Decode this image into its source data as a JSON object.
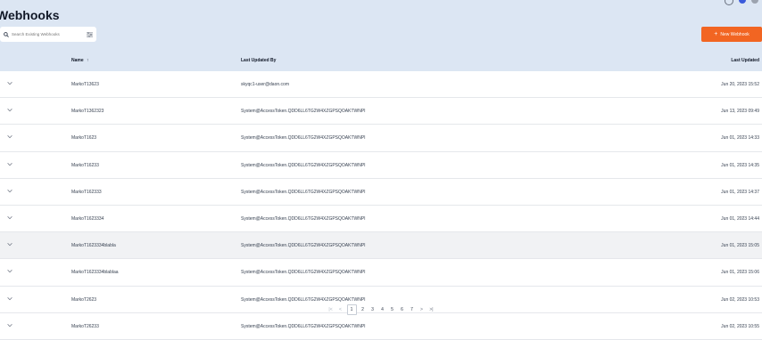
{
  "page": {
    "title": "Webhooks"
  },
  "search": {
    "placeholder": "Search Existing Webhooks"
  },
  "toolbar": {
    "new_label": "New Webhook",
    "new_icon": "plus-icon"
  },
  "colors": {
    "accent": "#f26522",
    "background": "#dce6f3"
  },
  "table": {
    "columns": {
      "name": "Name",
      "sort_indicator": "↑",
      "updated_by": "Last Updated By",
      "updated": "Last Updated"
    },
    "rows": [
      {
        "name": "MarkoT13623",
        "updated_by": "skyqc1-user@daon.com",
        "updated": "Jun 20, 2023 15:52"
      },
      {
        "name": "MarkoT1362323",
        "updated_by": "System@AccessToken.QDD6LL6TG2W4XZGPSQOAKTWNPI",
        "updated": "Jun 13, 2023 09:49"
      },
      {
        "name": "MarkoT1623",
        "updated_by": "System@AccessToken.QDD6LL6TG2W4XZGPSQOAKTWNPI",
        "updated": "Jun 01, 2023 14:33"
      },
      {
        "name": "MarkoT16233",
        "updated_by": "System@AccessToken.QDD6LL6TG2W4XZGPSQOAKTWNPI",
        "updated": "Jun 01, 2023 14:35"
      },
      {
        "name": "MarkoT162333",
        "updated_by": "System@AccessToken.QDD6LL6TG2W4XZGPSQOAKTWNPI",
        "updated": "Jun 01, 2023 14:37"
      },
      {
        "name": "MarkoT1623334",
        "updated_by": "System@AccessToken.QDD6LL6TG2W4XZGPSQOAKTWNPI",
        "updated": "Jun 01, 2023 14:44"
      },
      {
        "name": "MarkoT1623334blabla",
        "updated_by": "System@AccessToken.QDD6LL6TG2W4XZGPSQOAKTWNPI",
        "updated": "Jun 01, 2023 15:05"
      },
      {
        "name": "MarkoT1623334blablaa",
        "updated_by": "System@AccessToken.QDD6LL6TG2W4XZGPSQOAKTWNPI",
        "updated": "Jun 01, 2023 15:06"
      },
      {
        "name": "MarkoT2623",
        "updated_by": "System@AccessToken.QDD6LL6TG2W4XZGPSQOAKTWNPI",
        "updated": "Jun 02, 2023 10:53"
      },
      {
        "name": "MarkoT26233",
        "updated_by": "System@AccessToken.QDD6LL6TG2W4XZGPSQOAKTWNPI",
        "updated": "Jun 02, 2023 10:55"
      }
    ]
  },
  "pagination": {
    "first": "|<",
    "prev": "<",
    "next": ">",
    "last": ">|",
    "pages": [
      "1",
      "2",
      "3",
      "4",
      "5",
      "6",
      "7"
    ],
    "current": "1"
  }
}
